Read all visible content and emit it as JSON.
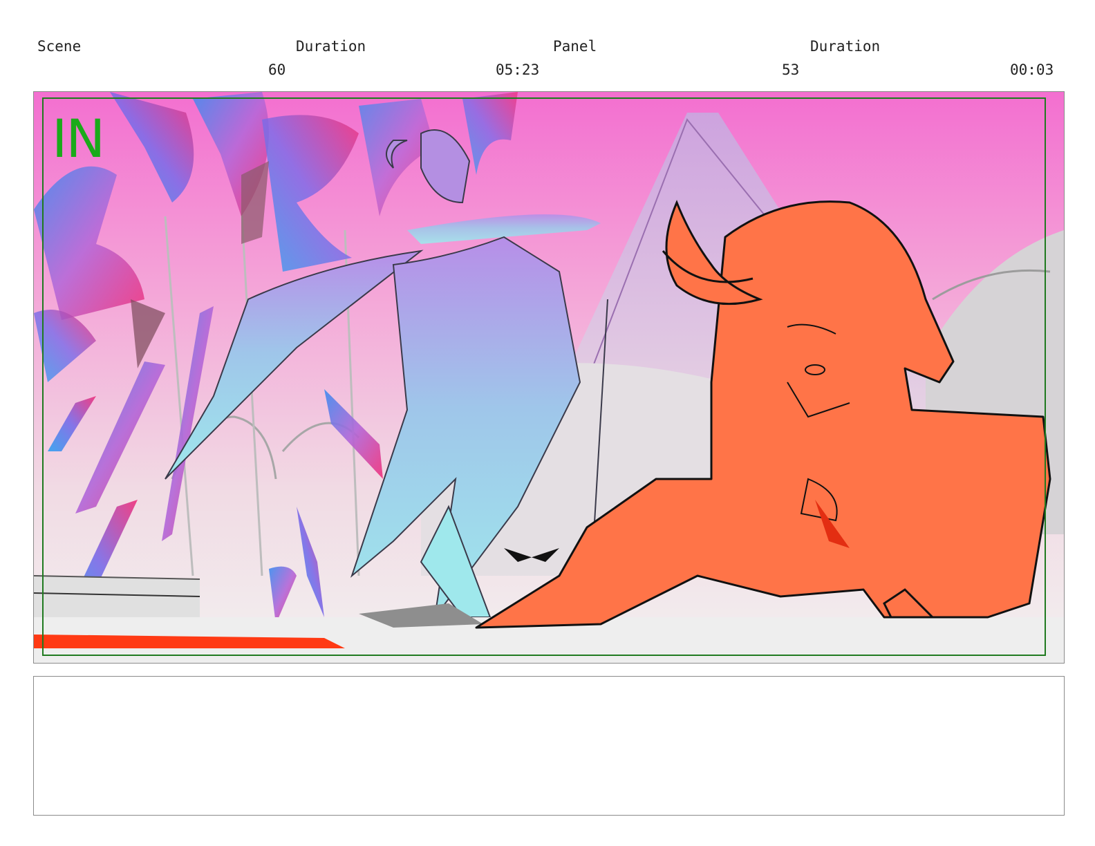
{
  "header": {
    "scene_label": "Scene",
    "scene_duration_label": "Duration",
    "panel_label": "Panel",
    "panel_duration_label": "Duration",
    "scene_value": "60",
    "scene_duration_value": "05:23",
    "panel_value": "53",
    "panel_duration_value": "00:03"
  },
  "panel": {
    "cue_text": "IN"
  },
  "notes": {
    "text": ""
  },
  "colors": {
    "safe_area": "#1f7a1f",
    "cue": "#1aaa1a",
    "figure_front": "#ff7448",
    "figure_back": "#9fe3ea",
    "sky_top": "#f36fd0",
    "ground_stripe": "#ff3a14"
  }
}
